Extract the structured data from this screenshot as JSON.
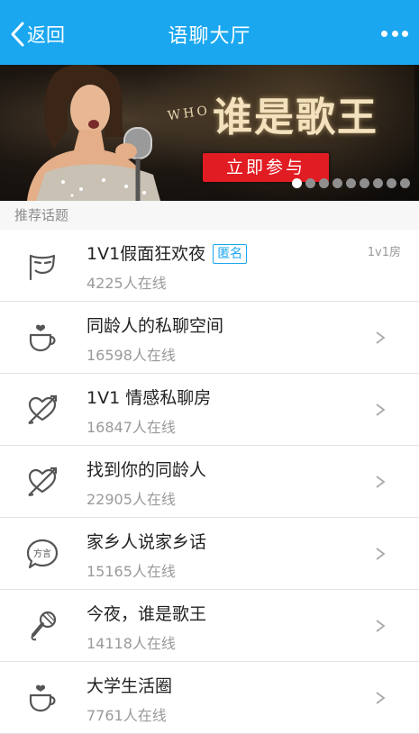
{
  "header": {
    "back_label": "返回",
    "title": "语聊大厅",
    "accent": "#1aa7f0"
  },
  "banner": {
    "small_text": "WHO",
    "title": "谁是歌王",
    "cta_label": "立即参与",
    "page_count": 9,
    "active_page": 1
  },
  "section": {
    "title": "推荐话题"
  },
  "topics": [
    {
      "name": "1V1假面狂欢夜",
      "badge": "匿名",
      "count": "4225人在线",
      "right_tag": "1v1房",
      "icon": "mask-icon"
    },
    {
      "name": "同龄人的私聊空间",
      "count": "16598人在线",
      "icon": "coffee-cup-icon"
    },
    {
      "name": "1V1 情感私聊房",
      "count": "16847人在线",
      "icon": "heart-arrow-icon"
    },
    {
      "name": "找到你的同龄人",
      "count": "22905人在线",
      "icon": "heart-arrow-icon"
    },
    {
      "name": "家乡人说家乡话",
      "count": "15165人在线",
      "icon": "dialect-bubble-icon",
      "icon_text": "方言"
    },
    {
      "name": "今夜，谁是歌王",
      "count": "14118人在线",
      "icon": "microphone-icon"
    },
    {
      "name": "大学生活圈",
      "count": "7761人在线",
      "icon": "coffee-cup-icon"
    }
  ]
}
